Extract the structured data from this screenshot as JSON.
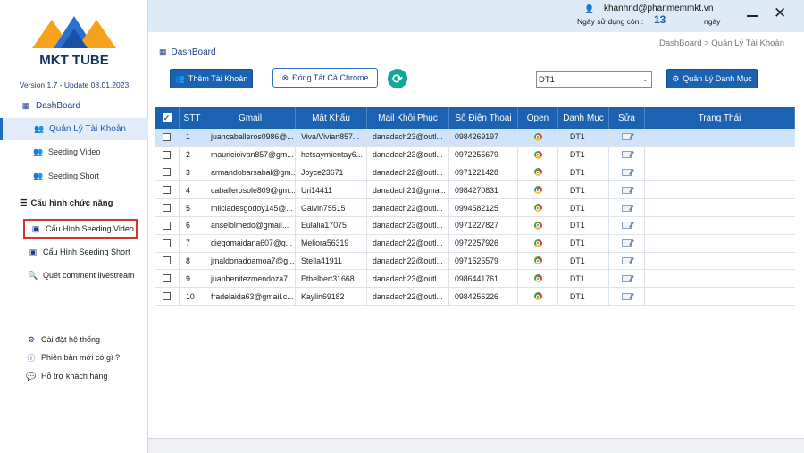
{
  "app": {
    "brand": "MKT TUBE",
    "version": "Version 1.7 - Update 08.01.2023"
  },
  "sidebar": {
    "dashboard": "DashBoard",
    "accounts": "Quản Lý Tài Khoản",
    "seeding_video": "Seeding Video",
    "seeding_short": "Seeding Short",
    "config_section": "Cấu hình chức năng",
    "config_seeding_video": "Cấu Hình Seeding Video",
    "config_seeding_short": "Cấu Hình Seeding Short",
    "scan_comment": "Quét comment livestream",
    "settings": "Cài đặt hệ thống",
    "whats_new": "Phiên bản mới có gì ?",
    "support": "Hỗ trợ khách hàng"
  },
  "header": {
    "email": "khanhnd@phanmemmkt.vn",
    "days_label": "Ngày sử dụng còn :",
    "days_value": "13",
    "days_unit": "ngày"
  },
  "page": {
    "title": "DashBoard",
    "breadcrumb": "DashBoard  >  Quản Lý Tài Khoản"
  },
  "toolbar": {
    "add_account": "Thêm Tài Khoản",
    "close_all_chrome": "Đóng Tất Cả Chrome",
    "category_selected": "DT1",
    "manage_category": "Quản Lý Danh Mục"
  },
  "table": {
    "columns": [
      "STT",
      "Gmail",
      "Mật Khẩu",
      "Mail Khôi Phục",
      "Số Điện Thoại",
      "Open",
      "Danh Mục",
      "Sửa",
      "Trạng Thái"
    ],
    "rows": [
      {
        "stt": "1",
        "gmail": "juancaballeros0986@...",
        "password": "Viva/Vivian857...",
        "recovery": "danadach23@outl...",
        "phone": "0984269197",
        "category": "DT1",
        "status": ""
      },
      {
        "stt": "2",
        "gmail": "mauricioivan857@gm...",
        "password": "hetsaymientay6...",
        "recovery": "danadach23@outl...",
        "phone": "0972255679",
        "category": "DT1",
        "status": ""
      },
      {
        "stt": "3",
        "gmail": "armandobarsabal@gm...",
        "password": "Joyce23671",
        "recovery": "danadach22@outl...",
        "phone": "0971221428",
        "category": "DT1",
        "status": ""
      },
      {
        "stt": "4",
        "gmail": "caballerosole809@gm...",
        "password": "Uri14411",
        "recovery": "danadach21@gma...",
        "phone": "0984270831",
        "category": "DT1",
        "status": ""
      },
      {
        "stt": "5",
        "gmail": "milciadesgodoy145@...",
        "password": "Galvin75515",
        "recovery": "danadach22@outl...",
        "phone": "0994582125",
        "category": "DT1",
        "status": ""
      },
      {
        "stt": "6",
        "gmail": "anselolmedo@gmail...",
        "password": "Eulalia17075",
        "recovery": "danadach23@outl...",
        "phone": "0971227827",
        "category": "DT1",
        "status": ""
      },
      {
        "stt": "7",
        "gmail": "diegomaidana607@g...",
        "password": "Meliora56319",
        "recovery": "danadach22@outl...",
        "phone": "0972257926",
        "category": "DT1",
        "status": ""
      },
      {
        "stt": "8",
        "gmail": "jmaldonadoamoa7@g...",
        "password": "Stella41911",
        "recovery": "danadach22@outl...",
        "phone": "0971525579",
        "category": "DT1",
        "status": ""
      },
      {
        "stt": "9",
        "gmail": "juanbenitezmendoza7...",
        "password": "Ethelbert31668",
        "recovery": "danadach23@outl...",
        "phone": "0986441761",
        "category": "DT1",
        "status": ""
      },
      {
        "stt": "10",
        "gmail": "fradelaida63@gmail.c...",
        "password": "Kaylin69182",
        "recovery": "danadach22@outl...",
        "phone": "0984256226",
        "category": "DT1",
        "status": ""
      }
    ]
  },
  "colors": {
    "primary": "#1b62b3",
    "header_bg": "#dfeaf7",
    "selected_row": "#cfe3fa",
    "highlight_border": "#d6332f",
    "refresh": "#12a79b"
  },
  "icons": {
    "dashboard": "dashboard-icon",
    "accounts": "users-icon",
    "seeding": "users-icon",
    "config": "list-icon",
    "config_item": "form-icon",
    "scan": "search-icon",
    "settings": "gear-icon",
    "whats_new": "info-icon",
    "support": "chat-icon",
    "open": "chrome-icon",
    "edit": "edit-icon",
    "refresh": "refresh-icon",
    "close_chrome": "close-circle-icon"
  }
}
